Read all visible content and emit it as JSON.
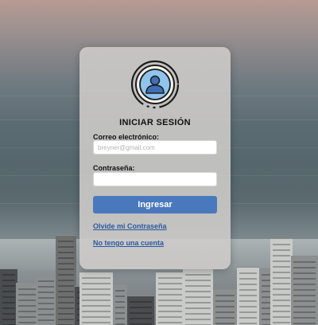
{
  "login": {
    "title": "INICIAR SESIÓN",
    "email_label": "Correo electrónico:",
    "email_placeholder": "breyner@gmail.com",
    "email_value": "",
    "password_label": "Contraseña:",
    "password_value": "",
    "submit_label": "Ingresar",
    "forgot_link": "Olvide mi Contraseña",
    "signup_link": "No tengo una cuenta",
    "avatar_icon": "user-avatar-icon"
  },
  "colors": {
    "button": "#4a78bd",
    "link": "#2d5aa0",
    "avatar_ring": "#1c1c1c",
    "avatar_fill": "#8fc4ec"
  }
}
